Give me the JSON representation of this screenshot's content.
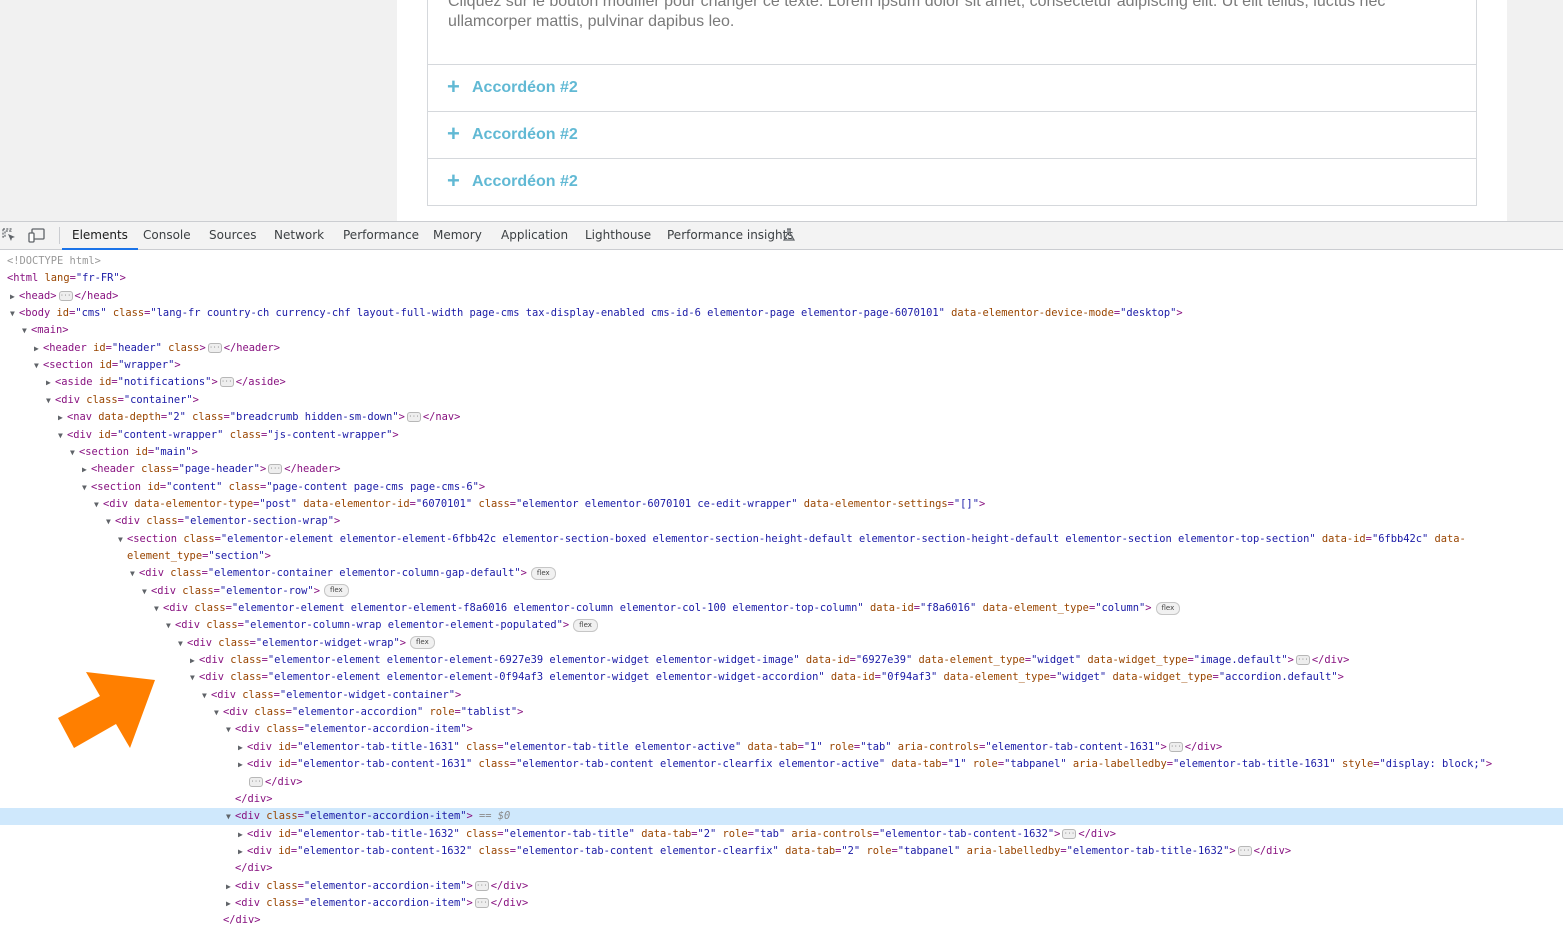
{
  "preview": {
    "accordion_text": "Cliquez sur le bouton modifier pour changer ce texte. Lorem ipsum dolor sit amet, consectetur adipiscing elit. Ut elit tellus, luctus nec ullamcorper mattis, pulvinar dapibus leo.",
    "items": [
      {
        "plus": "+",
        "title": "Accordéon #2"
      },
      {
        "plus": "+",
        "title": "Accordéon #2"
      },
      {
        "plus": "+",
        "title": "Accordéon #2"
      }
    ],
    "accent_color": "#61b9d4"
  },
  "devtools": {
    "tabs": [
      "Elements",
      "Console",
      "Sources",
      "Network",
      "Performance",
      "Memory",
      "Application",
      "Lighthouse",
      "Performance insights"
    ],
    "active_tab": "Elements",
    "icons": [
      "inspect-element-icon",
      "device-toolbar-icon",
      "flask-icon"
    ]
  },
  "tree": [
    {
      "indent": 0,
      "tw": "",
      "html": "<span class='doct'>&lt;!DOCTYPE html&gt;</span>"
    },
    {
      "indent": 0,
      "tw": "",
      "html": "<span class='tag'>&lt;html</span> <span class='an'>lang</span>=<span class='av'>\"fr-FR\"</span><span class='tag'>&gt;</span>"
    },
    {
      "indent": 1,
      "tw": "▶",
      "html": "<span class='tag'>&lt;head&gt;</span><span class='ell'>···</span><span class='tag'>&lt;/head&gt;</span>"
    },
    {
      "indent": 1,
      "tw": "▼",
      "html": "<span class='tag'>&lt;body</span> <span class='an'>id</span>=<span class='av'>\"cms\"</span> <span class='an'>class</span>=<span class='av'>\"lang-fr country-ch currency-chf layout-full-width page-cms tax-display-enabled cms-id-6 elementor-page elementor-page-6070101\"</span> <span class='an'>data-elementor-device-mode</span>=<span class='av'>\"desktop\"</span><span class='tag'>&gt;</span>"
    },
    {
      "indent": 2,
      "tw": "▼",
      "html": "<span class='tag'>&lt;main&gt;</span>"
    },
    {
      "indent": 3,
      "tw": "▶",
      "html": "<span class='tag'>&lt;header</span> <span class='an'>id</span>=<span class='av'>\"header\"</span> <span class='an'>class</span><span class='tag'>&gt;</span><span class='ell'>···</span><span class='tag'>&lt;/header&gt;</span>"
    },
    {
      "indent": 3,
      "tw": "▼",
      "html": "<span class='tag'>&lt;section</span> <span class='an'>id</span>=<span class='av'>\"wrapper\"</span><span class='tag'>&gt;</span>"
    },
    {
      "indent": 4,
      "tw": "▶",
      "html": "<span class='tag'>&lt;aside</span> <span class='an'>id</span>=<span class='av'>\"notifications\"</span><span class='tag'>&gt;</span><span class='ell'>···</span><span class='tag'>&lt;/aside&gt;</span>"
    },
    {
      "indent": 4,
      "tw": "▼",
      "html": "<span class='tag'>&lt;div</span> <span class='an'>class</span>=<span class='av'>\"container\"</span><span class='tag'>&gt;</span>"
    },
    {
      "indent": 5,
      "tw": "▶",
      "html": "<span class='tag'>&lt;nav</span> <span class='an'>data-depth</span>=<span class='av'>\"2\"</span> <span class='an'>class</span>=<span class='av'>\"breadcrumb hidden-sm-down\"</span><span class='tag'>&gt;</span><span class='ell'>···</span><span class='tag'>&lt;/nav&gt;</span>"
    },
    {
      "indent": 5,
      "tw": "▼",
      "html": "<span class='tag'>&lt;div</span> <span class='an'>id</span>=<span class='av'>\"content-wrapper\"</span> <span class='an'>class</span>=<span class='av'>\"js-content-wrapper\"</span><span class='tag'>&gt;</span>"
    },
    {
      "indent": 6,
      "tw": "▼",
      "html": "<span class='tag'>&lt;section</span> <span class='an'>id</span>=<span class='av'>\"main\"</span><span class='tag'>&gt;</span>"
    },
    {
      "indent": 7,
      "tw": "▶",
      "html": "<span class='tag'>&lt;header</span> <span class='an'>class</span>=<span class='av'>\"page-header\"</span><span class='tag'>&gt;</span><span class='ell'>···</span><span class='tag'>&lt;/header&gt;</span>"
    },
    {
      "indent": 7,
      "tw": "▼",
      "html": "<span class='tag'>&lt;section</span> <span class='an'>id</span>=<span class='av'>\"content\"</span> <span class='an'>class</span>=<span class='av'>\"page-content page-cms page-cms-6\"</span><span class='tag'>&gt;</span>"
    },
    {
      "indent": 8,
      "tw": "▼",
      "html": "<span class='tag'>&lt;div</span> <span class='an'>data-elementor-type</span>=<span class='av'>\"post\"</span> <span class='an'>data-elementor-id</span>=<span class='av'>\"6070101\"</span> <span class='an'>class</span>=<span class='av'>\"elementor elementor-6070101 ce-edit-wrapper\"</span> <span class='an'>data-elementor-settings</span>=<span class='av'>\"[]\"</span><span class='tag'>&gt;</span>"
    },
    {
      "indent": 9,
      "tw": "▼",
      "html": "<span class='tag'>&lt;div</span> <span class='an'>class</span>=<span class='av'>\"elementor-section-wrap\"</span><span class='tag'>&gt;</span>"
    },
    {
      "indent": 10,
      "tw": "▼",
      "html": "<span class='tag'>&lt;section</span> <span class='an'>class</span>=<span class='av'>\"elementor-element elementor-element-6fbb42c elementor-section-boxed elementor-section-height-default elementor-section-height-default elementor-section elementor-top-section\"</span> <span class='an'>data-id</span>=<span class='av'>\"6fbb42c\"</span> <span class='an'>data-</span>"
    },
    {
      "indent": 10,
      "tw": "",
      "html": "<span class='an'>element_type</span>=<span class='av'>\"section\"</span><span class='tag'>&gt;</span>"
    },
    {
      "indent": 11,
      "tw": "▼",
      "html": "<span class='tag'>&lt;div</span> <span class='an'>class</span>=<span class='av'>\"elementor-container elementor-column-gap-default\"</span><span class='tag'>&gt;</span><span class='flex'>flex</span>"
    },
    {
      "indent": 12,
      "tw": "▼",
      "html": "<span class='tag'>&lt;div</span> <span class='an'>class</span>=<span class='av'>\"elementor-row\"</span><span class='tag'>&gt;</span><span class='flex'>flex</span>"
    },
    {
      "indent": 13,
      "tw": "▼",
      "html": "<span class='tag'>&lt;div</span> <span class='an'>class</span>=<span class='av'>\"elementor-element elementor-element-f8a6016 elementor-column elementor-col-100 elementor-top-column\"</span> <span class='an'>data-id</span>=<span class='av'>\"f8a6016\"</span> <span class='an'>data-element_type</span>=<span class='av'>\"column\"</span><span class='tag'>&gt;</span><span class='flex'>flex</span>"
    },
    {
      "indent": 14,
      "tw": "▼",
      "html": "<span class='tag'>&lt;div</span> <span class='an'>class</span>=<span class='av'>\"elementor-column-wrap elementor-element-populated\"</span><span class='tag'>&gt;</span><span class='flex'>flex</span>"
    },
    {
      "indent": 15,
      "tw": "▼",
      "html": "<span class='tag'>&lt;div</span> <span class='an'>class</span>=<span class='av'>\"elementor-widget-wrap\"</span><span class='tag'>&gt;</span><span class='flex'>flex</span>"
    },
    {
      "indent": 16,
      "tw": "▶",
      "html": "<span class='tag'>&lt;div</span> <span class='an'>class</span>=<span class='av'>\"elementor-element elementor-element-6927e39 elementor-widget elementor-widget-image\"</span> <span class='an'>data-id</span>=<span class='av'>\"6927e39\"</span> <span class='an'>data-element_type</span>=<span class='av'>\"widget\"</span> <span class='an'>data-widget_type</span>=<span class='av'>\"image.default\"</span><span class='tag'>&gt;</span><span class='ell'>···</span><span class='tag'>&lt;/div&gt;</span>"
    },
    {
      "indent": 16,
      "tw": "▼",
      "html": "<span class='tag'>&lt;div</span> <span class='an'>class</span>=<span class='av'>\"elementor-element elementor-element-0f94af3 elementor-widget elementor-widget-accordion\"</span> <span class='an'>data-id</span>=<span class='av'>\"0f94af3\"</span> <span class='an'>data-element_type</span>=<span class='av'>\"widget\"</span> <span class='an'>data-widget_type</span>=<span class='av'>\"accordion.default\"</span><span class='tag'>&gt;</span>"
    },
    {
      "indent": 17,
      "tw": "▼",
      "html": "<span class='tag'>&lt;div</span> <span class='an'>class</span>=<span class='av'>\"elementor-widget-container\"</span><span class='tag'>&gt;</span>"
    },
    {
      "indent": 18,
      "tw": "▼",
      "html": "<span class='tag'>&lt;div</span> <span class='an'>class</span>=<span class='av'>\"elementor-accordion\"</span> <span class='an'>role</span>=<span class='av'>\"tablist\"</span><span class='tag'>&gt;</span>"
    },
    {
      "indent": 19,
      "tw": "▼",
      "html": "<span class='tag'>&lt;div</span> <span class='an'>class</span>=<span class='av'>\"elementor-accordion-item\"</span><span class='tag'>&gt;</span>"
    },
    {
      "indent": 20,
      "tw": "▶",
      "html": "<span class='tag'>&lt;div</span> <span class='an'>id</span>=<span class='av'>\"elementor-tab-title-1631\"</span> <span class='an'>class</span>=<span class='av'>\"elementor-tab-title elementor-active\"</span> <span class='an'>data-tab</span>=<span class='av'>\"1\"</span> <span class='an'>role</span>=<span class='av'>\"tab\"</span> <span class='an'>aria-controls</span>=<span class='av'>\"elementor-tab-content-1631\"</span><span class='tag'>&gt;</span><span class='ell'>···</span><span class='tag'>&lt;/div&gt;</span>"
    },
    {
      "indent": 20,
      "tw": "▶",
      "html": "<span class='tag'>&lt;div</span> <span class='an'>id</span>=<span class='av'>\"elementor-tab-content-1631\"</span> <span class='an'>class</span>=<span class='av'>\"elementor-tab-content elementor-clearfix elementor-active\"</span> <span class='an'>data-tab</span>=<span class='av'>\"1\"</span> <span class='an'>role</span>=<span class='av'>\"tabpanel\"</span> <span class='an'>aria-labelledby</span>=<span class='av'>\"elementor-tab-title-1631\"</span> <span class='an'>style</span>=<span class='av'>\"display: block;\"</span><span class='tag'>&gt;</span>"
    },
    {
      "indent": 20,
      "tw": "",
      "html": "<span class='ell'>···</span><span class='tag'>&lt;/div&gt;</span>"
    },
    {
      "indent": 19,
      "tw": "",
      "html": "<span class='tag'>&lt;/div&gt;</span>"
    },
    {
      "indent": 19,
      "tw": "▼",
      "sel": true,
      "html": "<span class='tag'>&lt;div</span> <span class='an'>class</span>=<span class='av'>\"elementor-accordion-item\"</span><span class='tag'>&gt;</span> <span class='dollar'>== $0</span>"
    },
    {
      "indent": 20,
      "tw": "▶",
      "html": "<span class='tag'>&lt;div</span> <span class='an'>id</span>=<span class='av'>\"elementor-tab-title-1632\"</span> <span class='an'>class</span>=<span class='av'>\"elementor-tab-title\"</span> <span class='an'>data-tab</span>=<span class='av'>\"2\"</span> <span class='an'>role</span>=<span class='av'>\"tab\"</span> <span class='an'>aria-controls</span>=<span class='av'>\"elementor-tab-content-1632\"</span><span class='tag'>&gt;</span><span class='ell'>···</span><span class='tag'>&lt;/div&gt;</span>"
    },
    {
      "indent": 20,
      "tw": "▶",
      "html": "<span class='tag'>&lt;div</span> <span class='an'>id</span>=<span class='av'>\"elementor-tab-content-1632\"</span> <span class='an'>class</span>=<span class='av'>\"elementor-tab-content elementor-clearfix\"</span> <span class='an'>data-tab</span>=<span class='av'>\"2\"</span> <span class='an'>role</span>=<span class='av'>\"tabpanel\"</span> <span class='an'>aria-labelledby</span>=<span class='av'>\"elementor-tab-title-1632\"</span><span class='tag'>&gt;</span><span class='ell'>···</span><span class='tag'>&lt;/div&gt;</span>"
    },
    {
      "indent": 19,
      "tw": "",
      "html": "<span class='tag'>&lt;/div&gt;</span>"
    },
    {
      "indent": 19,
      "tw": "▶",
      "html": "<span class='tag'>&lt;div</span> <span class='an'>class</span>=<span class='av'>\"elementor-accordion-item\"</span><span class='tag'>&gt;</span><span class='ell'>···</span><span class='tag'>&lt;/div&gt;</span>"
    },
    {
      "indent": 19,
      "tw": "▶",
      "html": "<span class='tag'>&lt;div</span> <span class='an'>class</span>=<span class='av'>\"elementor-accordion-item\"</span><span class='tag'>&gt;</span><span class='ell'>···</span><span class='tag'>&lt;/div&gt;</span>"
    },
    {
      "indent": 18,
      "tw": "",
      "html": "<span class='tag'>&lt;/div&gt;</span>"
    }
  ]
}
